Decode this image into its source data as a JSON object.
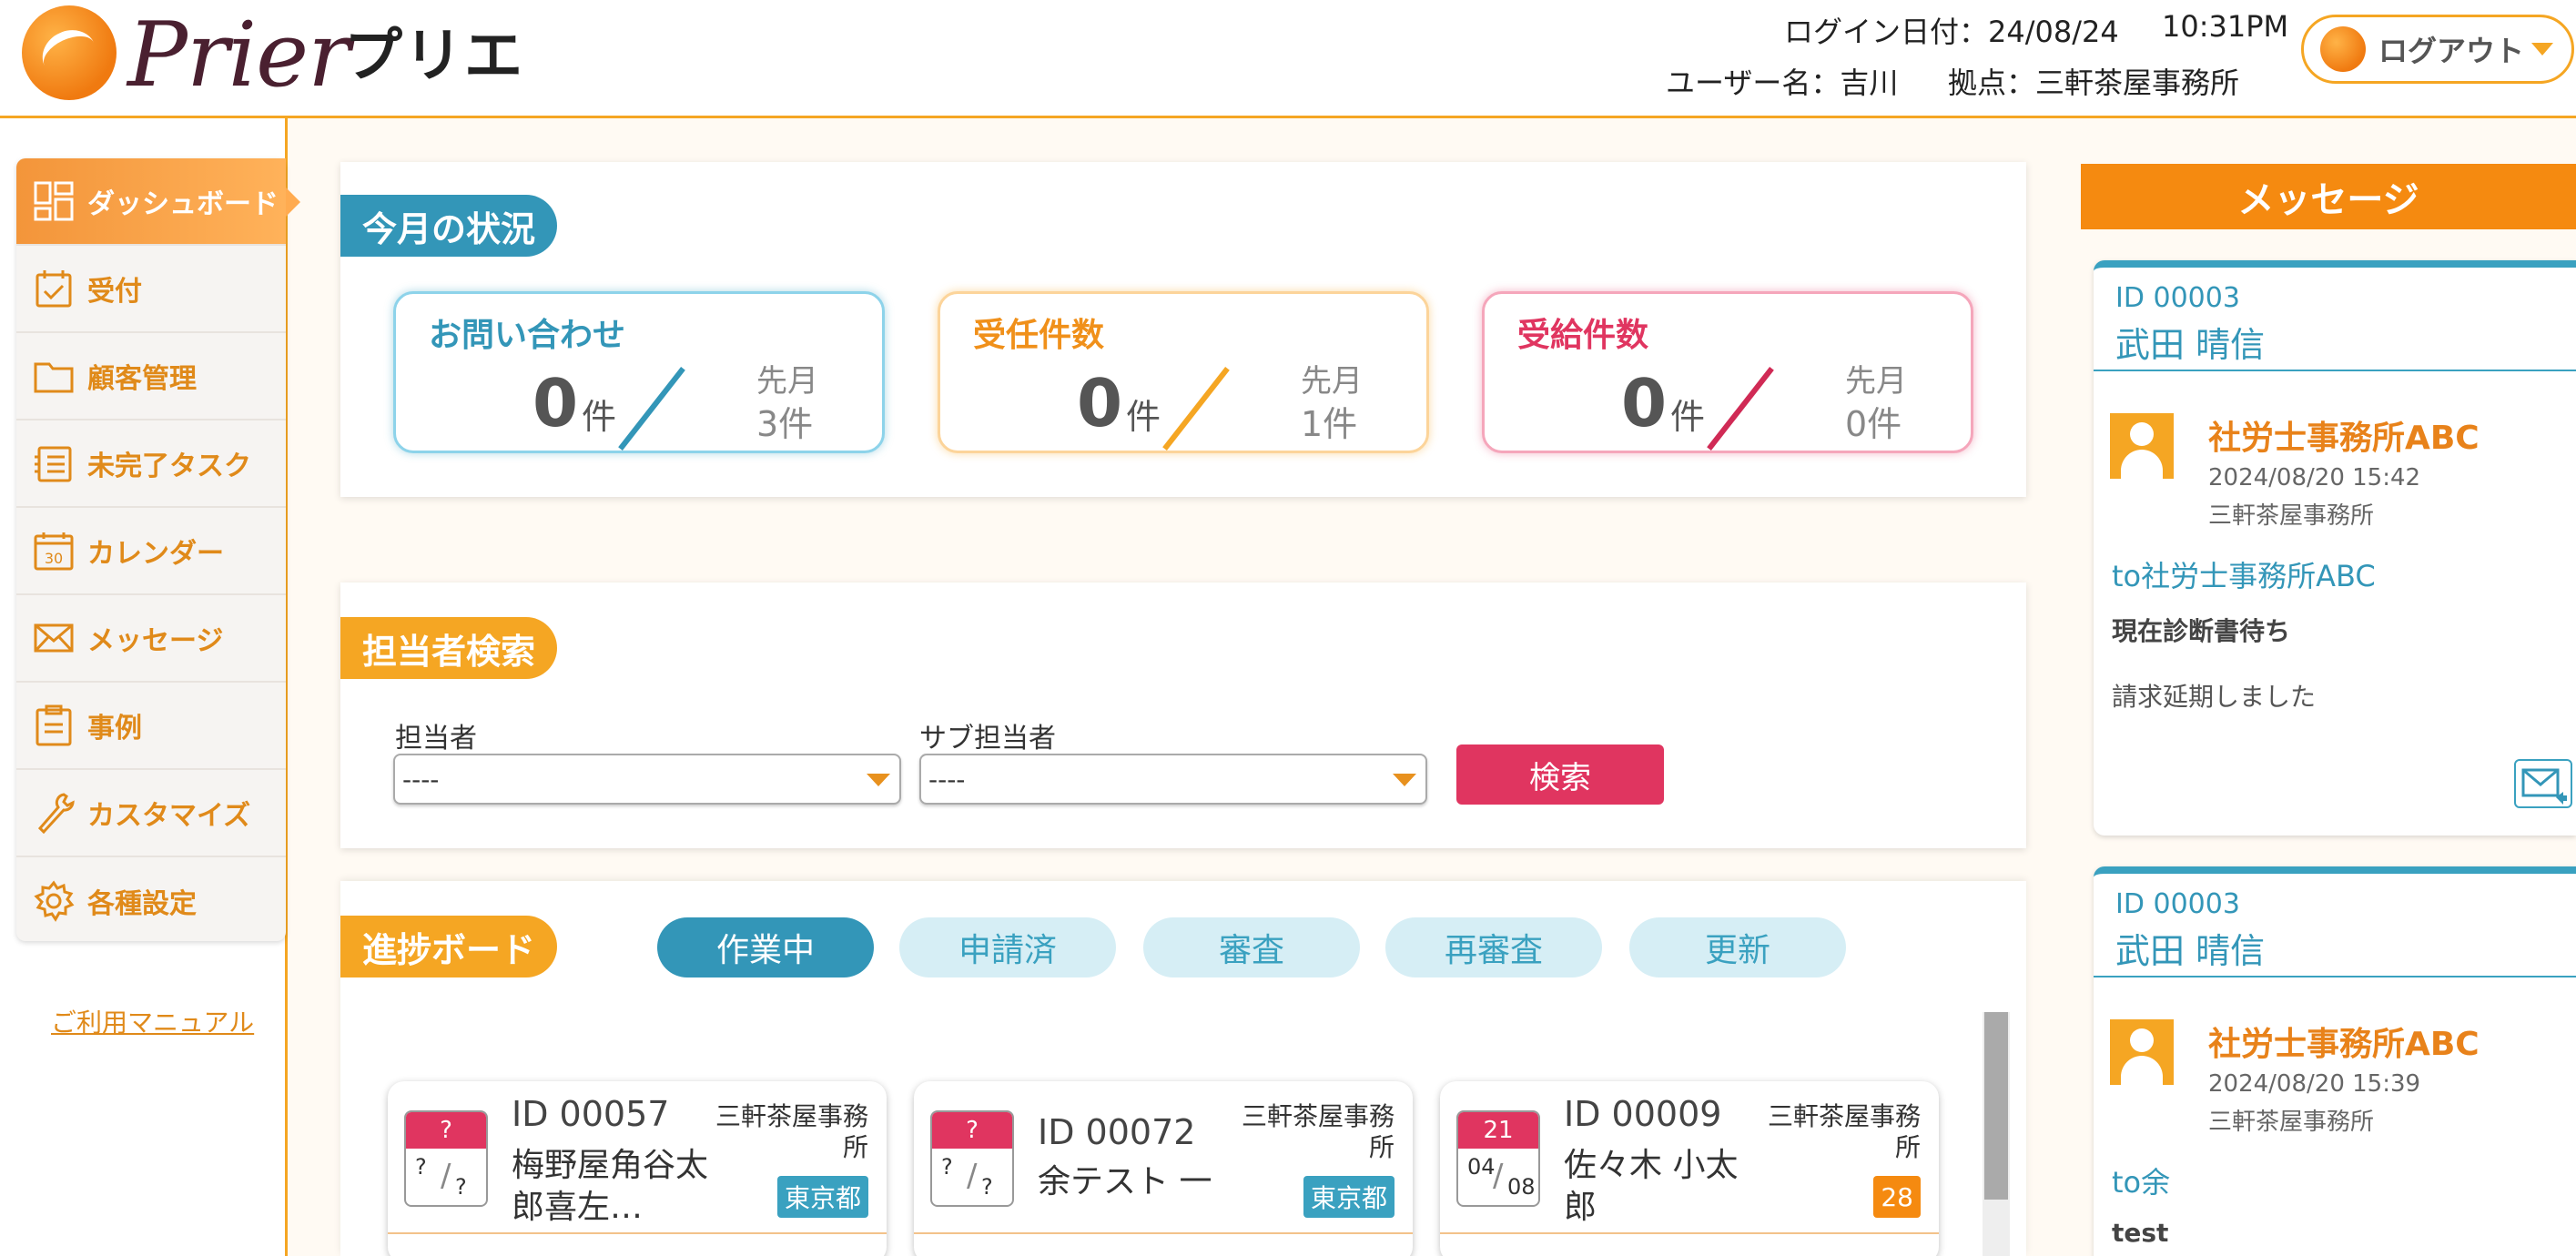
{
  "header": {
    "logo_text": "Prier",
    "app_name_jp": "プリエ",
    "login_date": "ログイン日付：24/08/24",
    "login_time": "10:31PM",
    "user": "ユーザー名：吉川",
    "site": "拠点：三軒茶屋事務所",
    "logout_label": "ログアウト"
  },
  "sidebar": {
    "items": [
      {
        "label": "ダッシュボード",
        "icon": "dashboard-icon"
      },
      {
        "label": "受付",
        "icon": "clipboard-check-icon"
      },
      {
        "label": "顧客管理",
        "icon": "folder-icon"
      },
      {
        "label": "未完了タスク",
        "icon": "task-list-icon"
      },
      {
        "label": "カレンダー",
        "icon": "calendar-icon"
      },
      {
        "label": "メッセージ",
        "icon": "envelope-icon"
      },
      {
        "label": "事例",
        "icon": "clipboard-icon"
      },
      {
        "label": "カスタマイズ",
        "icon": "wrench-icon"
      },
      {
        "label": "各種設定",
        "icon": "gear-icon"
      }
    ],
    "manual_link": "ご利用マニュアル"
  },
  "monthly_status": {
    "title": "今月の状況",
    "cards": [
      {
        "title": "お問い合わせ",
        "value": "0",
        "unit": "件",
        "prev_label": "先月",
        "prev_value": "3件",
        "color": "#3aa1c0"
      },
      {
        "title": "受任件数",
        "value": "0",
        "unit": "件",
        "prev_label": "先月",
        "prev_value": "1件",
        "color": "#f5a623"
      },
      {
        "title": "受給件数",
        "value": "0",
        "unit": "件",
        "prev_label": "先月",
        "prev_value": "0件",
        "color": "#e03560"
      }
    ]
  },
  "staff_search": {
    "title": "担当者検索",
    "staff_label": "担当者",
    "staff_value": "----",
    "sub_staff_label": "サブ担当者",
    "sub_staff_value": "----",
    "search_button": "検索"
  },
  "progress_board": {
    "title": "進捗ボード",
    "tabs": [
      "作業中",
      "申請済",
      "審査",
      "再審査",
      "更新"
    ],
    "cards": [
      {
        "cal_top": "?",
        "cal_month": "?",
        "cal_day": "?",
        "id": "ID 00057",
        "name": "梅野屋角谷太郎喜左…",
        "site": "三軒茶屋事務所",
        "badge": "東京都",
        "badge_color": "#3aa1c0"
      },
      {
        "cal_top": "?",
        "cal_month": "?",
        "cal_day": "?",
        "id": "ID 00072",
        "name": "余テスト 一",
        "site": "三軒茶屋事務所",
        "badge": "東京都",
        "badge_color": "#3aa1c0"
      },
      {
        "cal_top": "21",
        "cal_month": "04",
        "cal_day": "08",
        "id": "ID 00009",
        "name": "佐々木 小太郎",
        "site": "三軒茶屋事務所",
        "badge": "28",
        "badge_color": "#f58a10"
      }
    ]
  },
  "messages": {
    "title": "メッセージ",
    "items": [
      {
        "id": "ID 00003",
        "name": "武田 晴信",
        "from": "社労士事務所ABC",
        "time": "2024/08/20 15:42",
        "site": "三軒茶屋事務所",
        "to": "to社労士事務所ABC",
        "subject": "現在診断書待ち",
        "body": "請求延期しました"
      },
      {
        "id": "ID 00003",
        "name": "武田 晴信",
        "from": "社労士事務所ABC",
        "time": "2024/08/20 15:39",
        "site": "三軒茶屋事務所",
        "to": "to余",
        "subject": "test",
        "body": ""
      }
    ]
  }
}
